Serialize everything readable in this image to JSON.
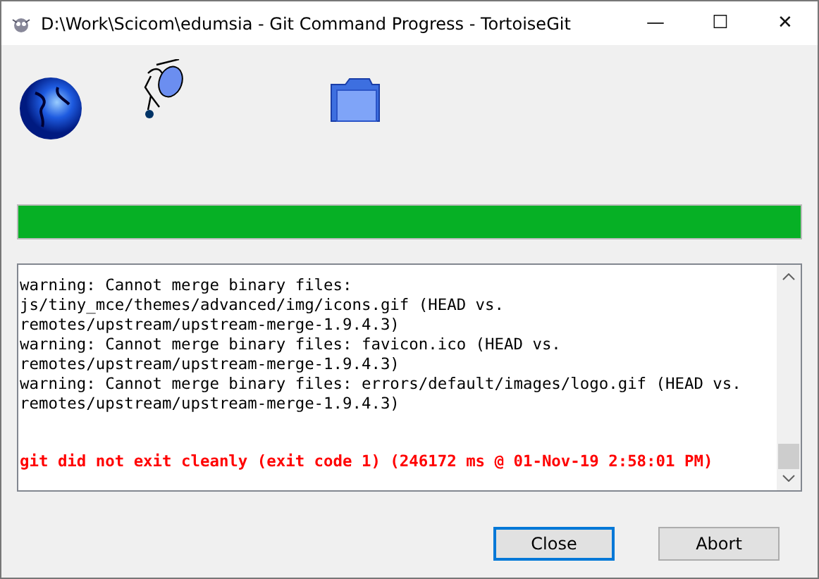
{
  "window": {
    "title": "D:\\Work\\Scicom\\edumsia - Git Command Progress - TortoiseGit",
    "controls": [
      "—",
      "☐",
      "✕"
    ]
  },
  "progress": {
    "level": 1
  },
  "log": [
    {
      "kind": "normal",
      "text": "warning: Cannot merge binary files:"
    },
    {
      "kind": "normal",
      "text": "js/tiny_mce/themes/advanced/img/icons.gif (HEAD vs."
    },
    {
      "kind": "normal",
      "text": "remotes/upstream/upstream-merge-1.9.4.3)"
    },
    {
      "kind": "normal",
      "text": "warning: Cannot merge binary files: favicon.ico (HEAD vs."
    },
    {
      "kind": "normal",
      "text": "remotes/upstream/upstream-merge-1.9.4.3)"
    },
    {
      "kind": "normal",
      "text": "warning: Cannot merge binary files: errors/default/images/logo.gif (HEAD vs."
    },
    {
      "kind": "normal",
      "text": "remotes/upstream/upstream-merge-1.9.4.3)"
    },
    {
      "kind": "error",
      "text": "git did not exit cleanly (exit code 1) (246172 ms @ 01-Nov-19 2:58:01 PM)"
    }
  ],
  "buttons": [
    {
      "label": "Close",
      "focused": true
    },
    {
      "label": "Abort",
      "focused": false
    }
  ]
}
